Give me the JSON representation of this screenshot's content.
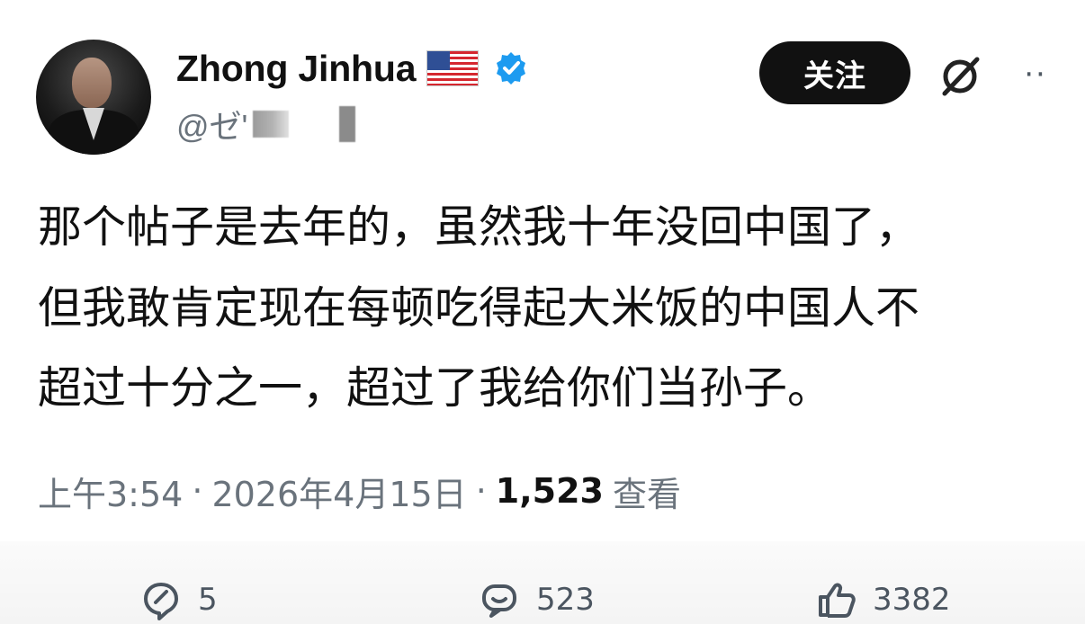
{
  "author": {
    "display_name": "Zhong Jinhua",
    "flag_icon": "us-flag-icon",
    "verified_icon": "verified-badge-icon",
    "handle": "@ゼ'",
    "avatar_icon": "avatar"
  },
  "header_actions": {
    "follow_label": "关注",
    "grok_icon": "grok-icon",
    "more_label": "··"
  },
  "post": {
    "lines": [
      "那个帖子是去年的，虽然我十年没回中国了，",
      "但我敢肯定现在每顿吃得起大米饭的中国人不",
      "超过十分之一，超过了我给你们当孙子。"
    ]
  },
  "meta": {
    "time": "上午3:54",
    "separator": "·",
    "date": "2026年4月15日",
    "views": "1,523",
    "views_label": "查看"
  },
  "engagement": {
    "reply_icon": "reply-icon",
    "reply_count": "5",
    "repost_icon": "comment-icon",
    "repost_count": "523",
    "like_icon": "thumbs-up-icon",
    "like_count": "3382"
  },
  "colors": {
    "text": "#111111",
    "muted": "#6a737c",
    "verified": "#1d9bf0",
    "follow_bg": "#111111"
  }
}
